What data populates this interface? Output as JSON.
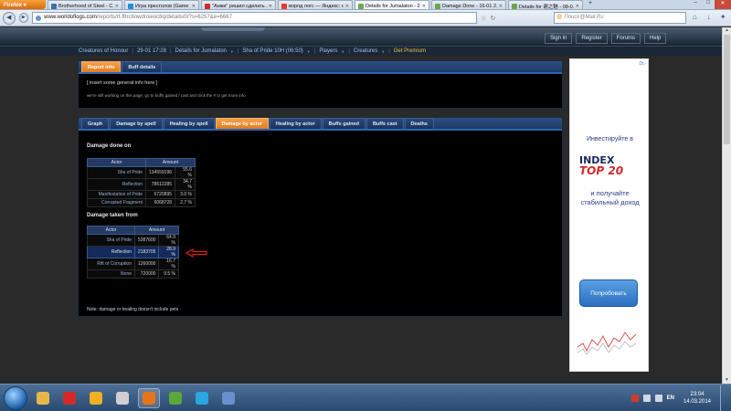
{
  "browser": {
    "app_button": "Firefox",
    "tabs": [
      {
        "label": "Brotherhood of Steel - C...",
        "icon_color": "#3a6ea5",
        "active": false
      },
      {
        "label": "Игра престолов (Game ...",
        "icon_color": "#1f8fd8",
        "active": false
      },
      {
        "label": "\"Анжи\" решил сделать ...",
        "icon_color": "#d22a2a",
        "active": false
      },
      {
        "label": "ворлд логс — Яндекс: н...",
        "icon_color": "#e63b2a",
        "active": false
      },
      {
        "label": "Details for Jumalaton - 2...",
        "icon_color": "#6aa84f",
        "active": true
      },
      {
        "label": "Damage Done - 16-01 2...",
        "icon_color": "#6aa84f",
        "active": false
      },
      {
        "label": "Details for 谢之魅 - 08-0...",
        "icon_color": "#6aa84f",
        "active": false
      }
    ],
    "new_tab": "+",
    "url_host": "www.worldoflogs.com",
    "url_path": "/reports/rt-f8rc6owdroieoc8q/details/0/?s=6257&e=6667",
    "search_placeholder": "Поиск@Mail.Ru",
    "search_brand": "@"
  },
  "site": {
    "top_links": [
      "Sign in",
      "Register",
      "Forums",
      "Help"
    ],
    "breadcrumbs": [
      {
        "label": "Creatures of Honour",
        "premium": false
      },
      {
        "label": "29-01 17:28",
        "premium": false
      },
      {
        "label": "Details for Jumalaton",
        "premium": false,
        "dropdown": true
      },
      {
        "label": "Sha of Pride 10H (06:50)",
        "premium": false,
        "dropdown": true
      },
      {
        "label": "Players",
        "premium": false,
        "dropdown": true
      },
      {
        "label": "Creatures",
        "premium": false,
        "dropdown": true
      },
      {
        "label": "Get Premium",
        "premium": true
      }
    ]
  },
  "info_panel": {
    "tabs": [
      "Report info",
      "Buff details"
    ],
    "active_tab": 0,
    "text": "[ insert some general info here ]",
    "note": "we're still working on this page; go to buffs gained / cast and click the # to get more info"
  },
  "details_panel": {
    "tabs": [
      "Graph",
      "Damage by spell",
      "Healing by spell",
      "Damage by actor",
      "Healing by actor",
      "Buffs gained",
      "Buffs cast",
      "Deaths"
    ],
    "active_tab": 3,
    "damage_done": {
      "title": "Damage done on",
      "headers": [
        "Actor",
        "Amount"
      ],
      "rows": [
        {
          "actor": "Sha of Pride",
          "amount": "134559196",
          "pct": "55.6 %",
          "highlight": false
        },
        {
          "actor": "Reflection",
          "amount": "78612285",
          "pct": "34.7 %",
          "highlight": false
        },
        {
          "actor": "Manifestation of Pride",
          "amount": "6720895",
          "pct": "3.0 %",
          "highlight": false
        },
        {
          "actor": "Corrupted Fragment",
          "amount": "6068728",
          "pct": "2.7 %",
          "highlight": false
        }
      ]
    },
    "damage_taken": {
      "title": "Damage taken from",
      "headers": [
        "Actor",
        "Amount"
      ],
      "rows": [
        {
          "actor": "Sha of Pride",
          "amount": "5387600",
          "pct": "64.9 %",
          "highlight": false
        },
        {
          "actor": "Reflection",
          "amount": "2183705",
          "pct": "28.9 %",
          "highlight": true
        },
        {
          "actor": "Rift of Corruption",
          "amount": "1260000",
          "pct": "16.7 %",
          "highlight": false
        },
        {
          "actor": "None",
          "amount": "720000",
          "pct": "9.5 %",
          "highlight": false
        }
      ]
    },
    "footnote": "Note: damage or healing doesn't include pets"
  },
  "ad": {
    "badge": "D▷",
    "headline": "Инвестируйте в",
    "logo_line1": "INDEX",
    "logo_line2": "TOP 20",
    "body": "и получайте стабильный доход",
    "button": "Попробовать",
    "brand_color": "#2a3a8a"
  },
  "taskbar": {
    "items": [
      {
        "name": "explorer-icon",
        "color": "#e6b84a"
      },
      {
        "name": "opera-icon",
        "color": "#d22a2a"
      },
      {
        "name": "aimp-icon",
        "color": "#f0b020"
      },
      {
        "name": "steam-icon",
        "color": "#cfcfcf"
      },
      {
        "name": "firefox-icon",
        "color": "#e8741c",
        "active": true
      },
      {
        "name": "utorrent-icon",
        "color": "#5aa83a"
      },
      {
        "name": "skype-icon",
        "color": "#2aa6e0"
      },
      {
        "name": "teamspeak-icon",
        "color": "#6a8fd0"
      }
    ],
    "lang": "EN",
    "time": "23:04",
    "date": "14.03.2014"
  }
}
